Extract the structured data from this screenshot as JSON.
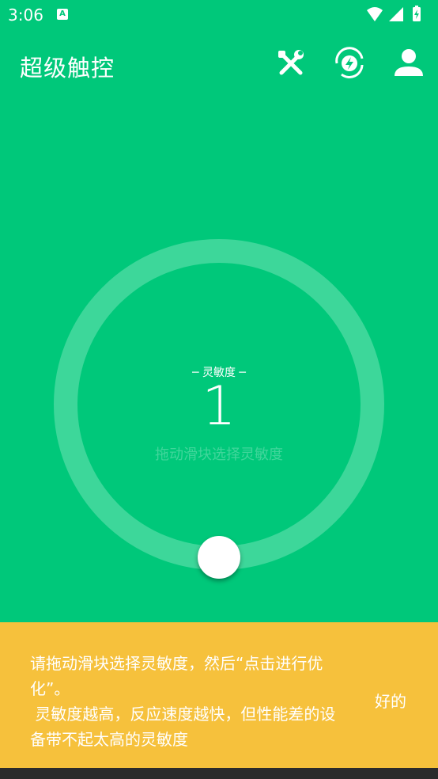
{
  "status_bar": {
    "time": "3:06",
    "notification_icon": "text-a-icon"
  },
  "app_bar": {
    "title": "超级触控",
    "icons": [
      "tools-icon",
      "boost-icon",
      "account-icon"
    ]
  },
  "sensitivity": {
    "label": "─ 灵敏度 ─",
    "value": "1",
    "hint": "拖动滑块选择灵敏度",
    "slider_level": 1
  },
  "snackbar": {
    "message": "请拖动滑块选择灵敏度，然后“点击进行优化”。\n 灵敏度越高，反应速度越快，但性能差的设备带不起太高的灵敏度",
    "action": "好的"
  },
  "colors": {
    "background": "#00C87A",
    "snackbar": "#F6C13C",
    "ring": "#3DD79A"
  }
}
